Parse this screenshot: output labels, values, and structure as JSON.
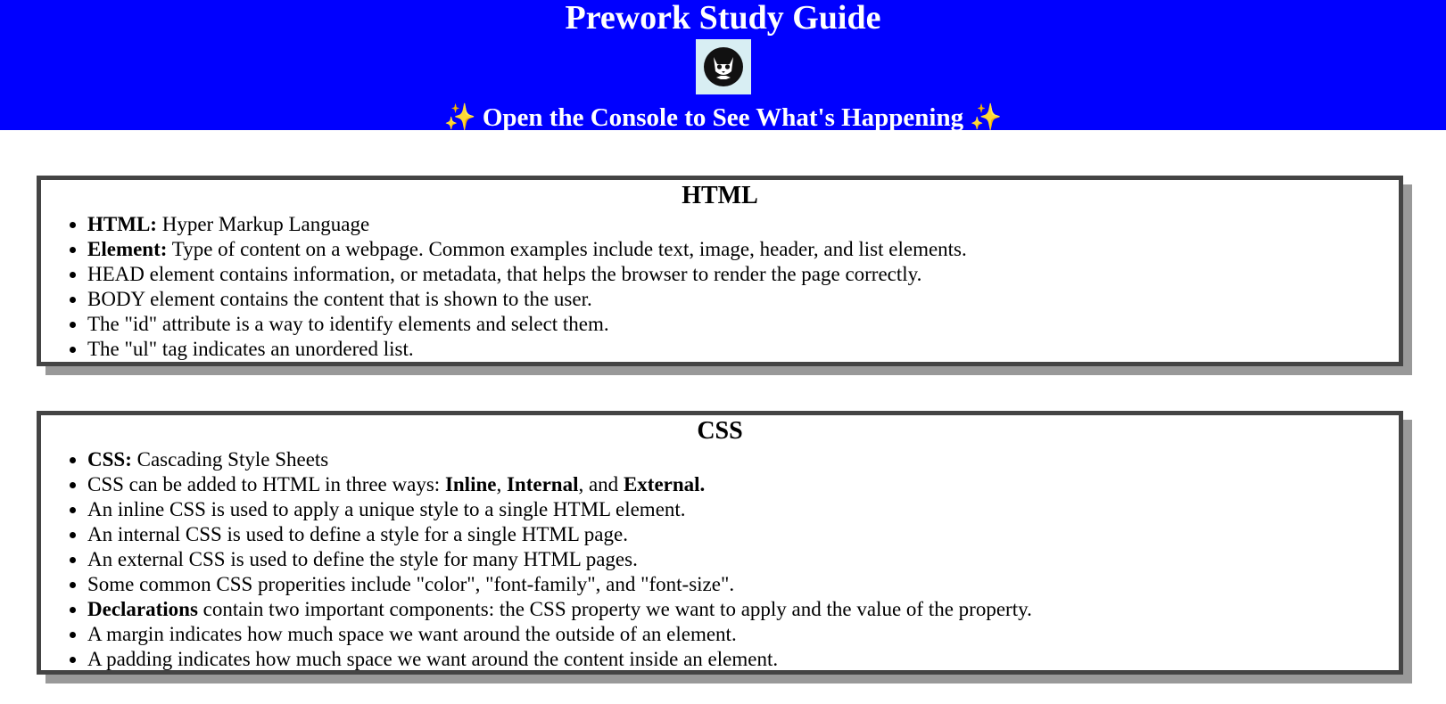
{
  "header": {
    "title": "Prework Study Guide",
    "subtitle_sparkle_left": "✨",
    "subtitle": "Open the Console to See What's Happening",
    "subtitle_sparkle_right": "✨",
    "logo_icon": "cat-avatar-icon",
    "colors": {
      "background": "#0000ff",
      "text": "#ffffff",
      "logo_bg": "#d8eef3"
    }
  },
  "html_section": {
    "heading": "HTML",
    "items": [
      {
        "bold": "HTML:",
        "text": " Hyper Markup Language"
      },
      {
        "bold": "Element:",
        "text": " Type of content on a webpage. Common examples include text, image, header, and list elements."
      },
      {
        "text": "HEAD element contains information, or metadata, that helps the browser to render the page correctly."
      },
      {
        "text": "BODY element contains the content that is shown to the user."
      },
      {
        "text": "The \"id\" attribute is a way to identify elements and select them."
      },
      {
        "text": "The \"ul\" tag indicates an unordered list."
      }
    ]
  },
  "css_section": {
    "heading": "CSS",
    "items": [
      {
        "bold": "CSS:",
        "text": " Cascading Style Sheets"
      },
      {
        "text": "CSS can be added to HTML in three ways: ",
        "b1": "Inline",
        "t2": ", ",
        "b2": "Internal",
        "t3": ", and ",
        "b3": "External."
      },
      {
        "text": "An inline CSS is used to apply a unique style to a single HTML element."
      },
      {
        "text": "An internal CSS is used to define a style for a single HTML page."
      },
      {
        "text": "An external CSS is used to define the style for many HTML pages."
      },
      {
        "text": "Some common CSS properities include \"color\", \"font-family\", and \"font-size\"."
      },
      {
        "bold": "Declarations",
        "text": " contain two important components: the CSS property we want to apply and the value of the property."
      },
      {
        "text": "A margin indicates how much space we want around the outside of an element."
      },
      {
        "text": "A padding indicates how much space we want around the content inside an element."
      }
    ]
  }
}
